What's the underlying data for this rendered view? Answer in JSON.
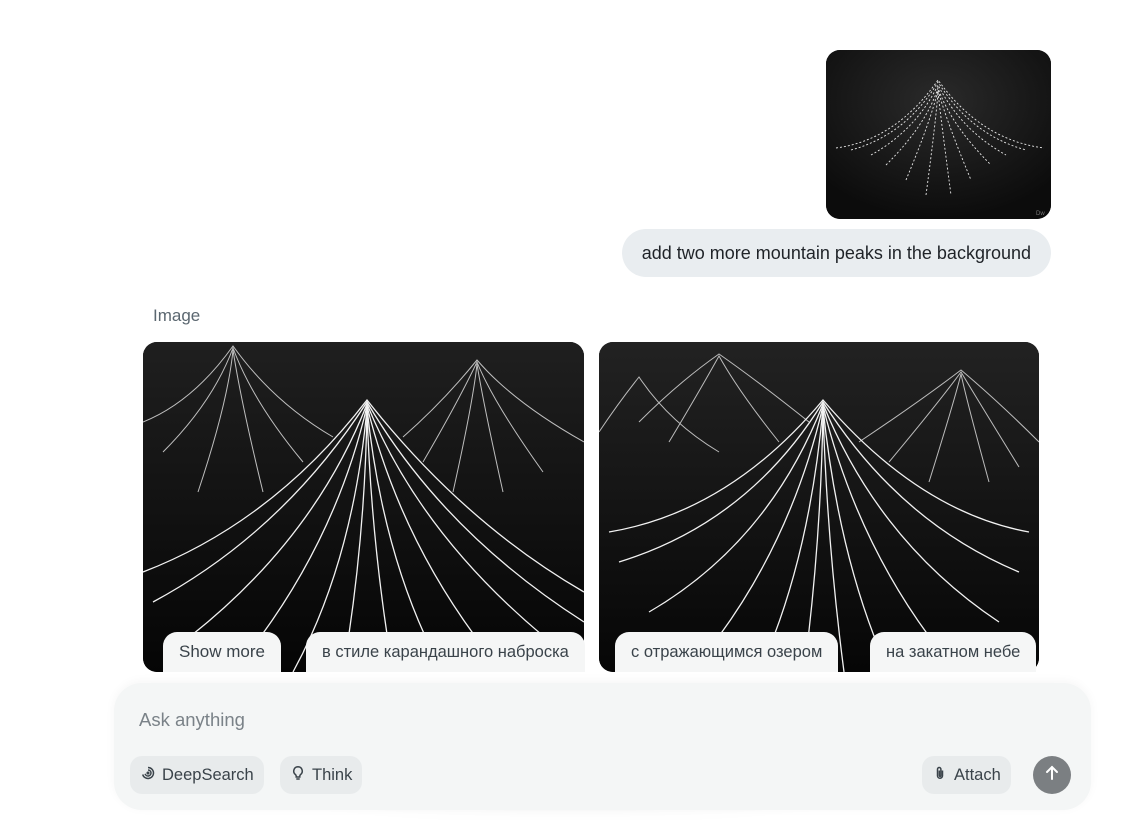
{
  "conversation": {
    "user_image": {
      "signature": "Dw"
    },
    "user_message": "add two more mountain peaks in the background",
    "response_label": "Image"
  },
  "suggestions": {
    "show_more": "Show more",
    "items": [
      "в стиле карандашного наброска",
      "с отражающимся озером",
      "на закатном небе"
    ]
  },
  "composer": {
    "placeholder": "Ask anything",
    "deepsearch_label": "DeepSearch",
    "think_label": "Think",
    "attach_label": "Attach",
    "icons": {
      "deepsearch": "deepsearch-icon",
      "think": "lightbulb-icon",
      "attach": "paperclip-icon",
      "send": "arrow-up-icon"
    }
  },
  "colors": {
    "bubble_bg": "#e9edf0",
    "composer_bg": "#f4f6f6",
    "send_button": "#7b7f82"
  }
}
